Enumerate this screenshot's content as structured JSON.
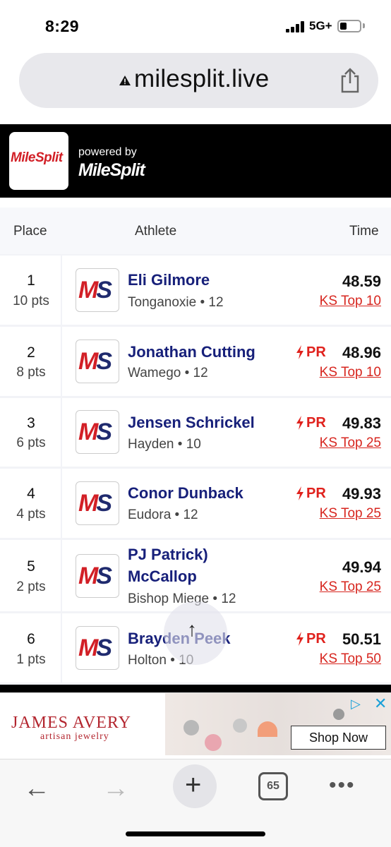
{
  "status_bar": {
    "time": "8:29",
    "network": "5G+"
  },
  "browser": {
    "url": "milesplit.live",
    "tab_count": "65"
  },
  "header": {
    "logo": "MileSplit",
    "powered_by": "powered by",
    "brand": "MileSplit"
  },
  "table": {
    "columns": {
      "place": "Place",
      "athlete": "Athlete",
      "time": "Time"
    },
    "rows": [
      {
        "place": "1",
        "pts": "10 pts",
        "name": "Eli Gilmore",
        "name2": "",
        "school": "Tonganoxie • 12",
        "pr": "",
        "time": "48.59",
        "rank": "KS Top 10"
      },
      {
        "place": "2",
        "pts": "8 pts",
        "name": "Jonathan Cutting",
        "name2": "",
        "school": "Wamego • 12",
        "pr": "PR",
        "time": "48.96",
        "rank": "KS Top 10"
      },
      {
        "place": "3",
        "pts": "6 pts",
        "name": "Jensen Schrickel",
        "name2": "",
        "school": "Hayden • 10",
        "pr": "PR",
        "time": "49.83",
        "rank": "KS Top 25"
      },
      {
        "place": "4",
        "pts": "4 pts",
        "name": "Conor Dunback",
        "name2": "",
        "school": "Eudora • 12",
        "pr": "PR",
        "time": "49.93",
        "rank": "KS Top 25"
      },
      {
        "place": "5",
        "pts": "2 pts",
        "name": "PJ Patrick)",
        "name2": "McCallop",
        "school": "Bishop Miege • 12",
        "pr": "",
        "time": "49.94",
        "rank": "KS Top 25"
      },
      {
        "place": "6",
        "pts": "1 pts",
        "name": "Brayden Peek",
        "name2": "",
        "school": "Holton • 10",
        "pr": "PR",
        "time": "50.51",
        "rank": "KS Top 50"
      }
    ]
  },
  "ad": {
    "brand": "JAMES AVERY",
    "tagline": "artisan jewelry",
    "cta": "Shop Now"
  },
  "icons": {
    "share": "share-icon",
    "back": "back-arrow-icon",
    "forward": "forward-arrow-icon",
    "new_tab": "plus-icon",
    "more": "more-icon",
    "scroll_top": "arrow-up-icon"
  },
  "colors": {
    "accent_red": "#d7261f",
    "brand_navy": "#17207a"
  }
}
